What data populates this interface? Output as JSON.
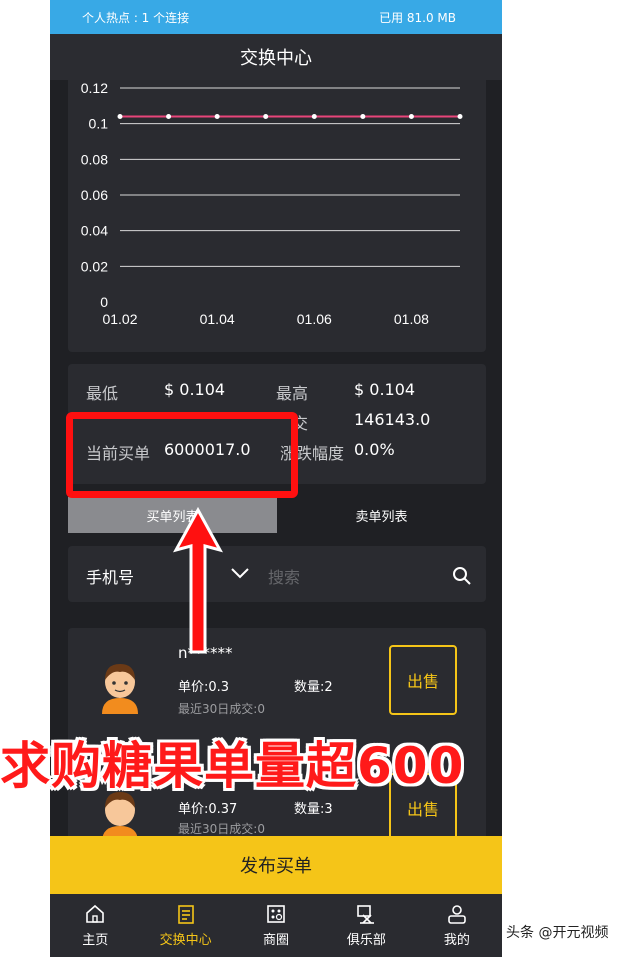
{
  "status_bar": {
    "left": "个人热点 : 1 个连接",
    "right": "已用 81.0 MB"
  },
  "title": "交换中心",
  "chart_data": {
    "type": "line",
    "x": [
      "01.02",
      "01.03",
      "01.04",
      "01.05",
      "01.06",
      "01.07",
      "01.08",
      "01.09"
    ],
    "xticks": [
      "01.02",
      "01.04",
      "01.06",
      "01.08"
    ],
    "series": [
      {
        "values": [
          0.104,
          0.104,
          0.104,
          0.104,
          0.104,
          0.104,
          0.104,
          0.104
        ]
      }
    ],
    "yticks": [
      "0",
      "0.02",
      "0.04",
      "0.06",
      "0.08",
      "0.1",
      "0.12"
    ],
    "ylim": [
      0,
      0.12
    ],
    "grid": true,
    "line_color": "#e8457a"
  },
  "stats": {
    "low_label": "最低",
    "low_value": "$ 0.104",
    "high_label": "最高",
    "high_value": "$ 0.104",
    "volume_label": "交",
    "volume_value": "146143.0",
    "buy_label": "当前买单",
    "buy_value": "6000017.0",
    "change_label": "涨跌幅度",
    "change_value": "0.0%"
  },
  "tabs": {
    "buy": "买单列表",
    "sell": "卖单列表"
  },
  "search": {
    "label": "手机号",
    "placeholder": "搜索"
  },
  "orders": [
    {
      "user": "n******",
      "price": "单价:0.3",
      "qty": "数量:2",
      "recent": "最近30日成交:0",
      "action": "出售"
    },
    {
      "price": "单价:0.37",
      "qty": "数量:3",
      "recent": "最近30日成交:0",
      "action": "出售"
    }
  ],
  "publish_label": "发布买单",
  "nav": [
    {
      "label": "主页",
      "icon": "home-icon"
    },
    {
      "label": "交换中心",
      "icon": "exchange-icon"
    },
    {
      "label": "商圈",
      "icon": "shop-icon"
    },
    {
      "label": "俱乐部",
      "icon": "club-icon"
    },
    {
      "label": "我的",
      "icon": "profile-icon"
    }
  ],
  "overlay": "求购糖果单量超600",
  "watermark": "头条 @开元视频",
  "colors": {
    "accent": "#f5c518",
    "status_bar": "#38a9e6",
    "highlight": "#ff1010"
  }
}
